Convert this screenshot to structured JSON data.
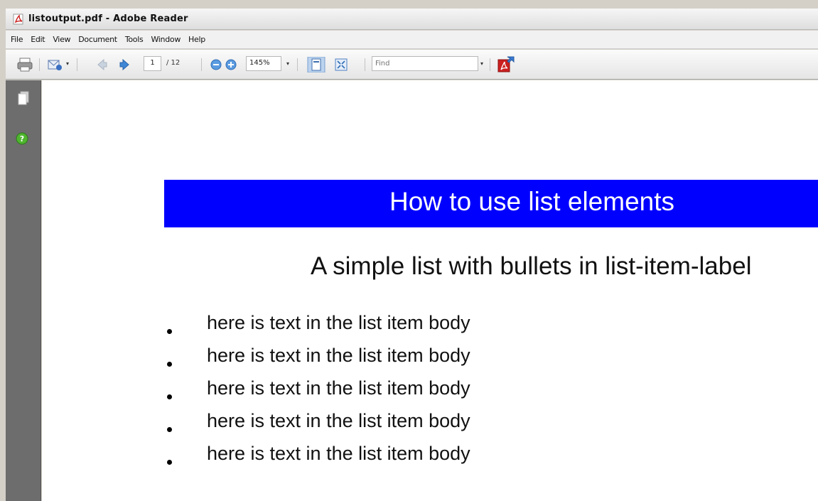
{
  "window": {
    "title": "listoutput.pdf - Adobe Reader"
  },
  "menu": [
    "File",
    "Edit",
    "View",
    "Document",
    "Tools",
    "Window",
    "Help"
  ],
  "toolbar": {
    "page_current": "1",
    "page_total": "/ 12",
    "zoom": "145%",
    "find_placeholder": "Find"
  },
  "document": {
    "heading": "How to use list elements",
    "subheading": "A simple list with bullets in list-item-label",
    "list_items": [
      "here is text in the list item body",
      "here is text in the list item body",
      "here is text in the list item body",
      "here is text in the list item body",
      "here is text in the list item body"
    ]
  },
  "colors": {
    "heading_band": "#0000ff",
    "nav_pane": "#6d6d6d",
    "pdf_icon_red": "#cc1f1f"
  },
  "icons": [
    "adobe-pdf-icon",
    "print-icon",
    "email-icon",
    "previous-page-icon",
    "next-page-icon",
    "zoom-out-icon",
    "zoom-in-icon",
    "single-page-icon",
    "fit-page-icon",
    "acrobat-icon",
    "pages-panel-icon",
    "help-icon"
  ]
}
